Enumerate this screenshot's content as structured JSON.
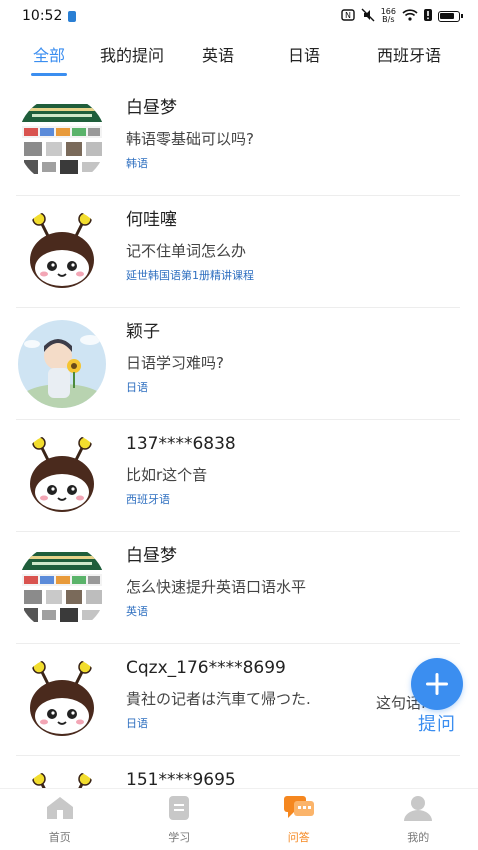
{
  "status_bar": {
    "time": "10:52",
    "net_speed_top": "166",
    "net_speed_bottom": "B/s"
  },
  "tabs": [
    {
      "label": "全部",
      "active": true
    },
    {
      "label": "我的提问",
      "active": false
    },
    {
      "label": "英语",
      "active": false
    },
    {
      "label": "日语",
      "active": false
    },
    {
      "label": "西班牙语",
      "active": false
    }
  ],
  "questions": [
    {
      "user": "白昼梦",
      "question": "韩语零基础可以吗?",
      "tag": "韩语",
      "avatar": "shop-avatar"
    },
    {
      "user": "何哇噻",
      "question": "记不住单词怎么办",
      "tag": "延世韩国语第1册精讲课程",
      "avatar": "bee-avatar"
    },
    {
      "user": "颖子",
      "question": "日语学习难吗?",
      "tag": "日语",
      "avatar": "girl-avatar"
    },
    {
      "user": "137****6838",
      "question": "比如r这个音",
      "tag": "西班牙语",
      "avatar": "bee-avatar"
    },
    {
      "user": "白昼梦",
      "question": "怎么快速提升英语口语水平",
      "tag": "英语",
      "avatar": "shop-avatar"
    },
    {
      "user": "Cqzx_176****8699",
      "question": "貴社の记者は汽車て帰つた.",
      "reply_hint": "这句话...",
      "tag": "日语",
      "avatar": "bee-avatar"
    },
    {
      "user": "151****9695",
      "question": "",
      "tag": "",
      "avatar": "bee-avatar"
    }
  ],
  "fab": {
    "label": "提问"
  },
  "bottom_nav": [
    {
      "label": "首页",
      "icon": "home-icon",
      "active": false
    },
    {
      "label": "学习",
      "icon": "study-icon",
      "active": false
    },
    {
      "label": "问答",
      "icon": "qa-icon",
      "active": true
    },
    {
      "label": "我的",
      "icon": "profile-icon",
      "active": false
    }
  ],
  "colors": {
    "accent": "#3b8ef0",
    "active_nav": "#f5871f",
    "tag": "#2f6fc0"
  }
}
